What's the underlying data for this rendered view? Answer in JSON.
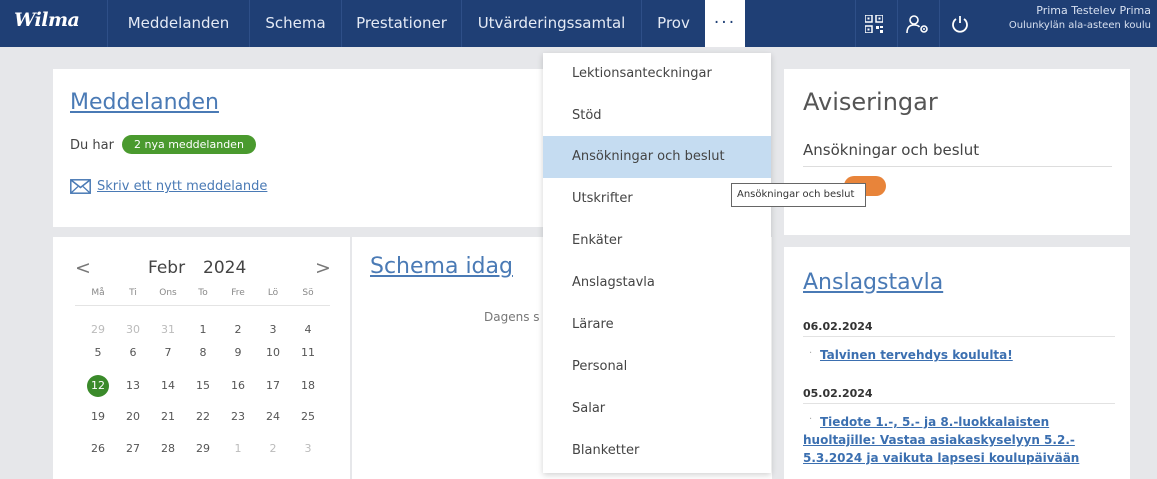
{
  "app": {
    "logo": "Wilma"
  },
  "nav": {
    "items": [
      "Meddelanden",
      "Schema",
      "Prestationer",
      "Utvärderingssamtal",
      "Prov"
    ],
    "more_label": "···"
  },
  "header_icons": [
    "qr-code-icon",
    "user-settings-icon",
    "power-icon"
  ],
  "user": {
    "name": "Prima Testelev Prima",
    "school": "Oulunkylän ala-asteen koulu"
  },
  "messages": {
    "title": "Meddelanden",
    "you_have": "Du har",
    "badge": "2 nya meddelanden",
    "write_new": "Skriv ett nytt meddelande"
  },
  "calendar": {
    "month": "Febr",
    "year": "2024",
    "prev": "<",
    "next": ">",
    "weekdays": [
      "Må",
      "Ti",
      "Ons",
      "To",
      "Fre",
      "Lö",
      "Sö"
    ],
    "weeks": [
      [
        "29",
        "30",
        "31",
        "1",
        "2",
        "3",
        "4"
      ],
      [
        "5",
        "6",
        "7",
        "8",
        "9",
        "10",
        "11"
      ],
      [
        "12",
        "13",
        "14",
        "15",
        "16",
        "17",
        "18"
      ],
      [
        "19",
        "20",
        "21",
        "22",
        "23",
        "24",
        "25"
      ],
      [
        "26",
        "27",
        "28",
        "29",
        "1",
        "2",
        "3"
      ]
    ],
    "today": "12"
  },
  "schedule": {
    "title": "Schema idag",
    "empty_text": "Dagens s"
  },
  "dropdown": {
    "items": [
      "Lektionsanteckningar",
      "Stöd",
      "Ansökningar och beslut",
      "Utskrifter",
      "Enkäter",
      "Anslagstavla",
      "Lärare",
      "Personal",
      "Salar",
      "Blanketter"
    ],
    "active_index": 2
  },
  "tooltip": "Ansökningar och beslut",
  "notices": {
    "title": "Aviseringar",
    "item": "Ansökningar och beslut"
  },
  "board": {
    "title": "Anslagstavla",
    "entries": [
      {
        "date": "06.02.2024",
        "lines": [
          "Talvinen tervehdys koululta!"
        ]
      },
      {
        "date": "05.02.2024",
        "lines": [
          "Tiedote 1.-, 5.- ja 8.-luokkalaisten",
          "huoltajille: Vastaa asiakaskyselyyn 5.2.-",
          "5.3.2024 ja vaikuta lapsesi koulupäivään"
        ]
      }
    ]
  },
  "colors": {
    "nav_bg": "#1f3f75",
    "link": "#4a7ab5",
    "badge": "#4a9a2e",
    "today": "#3a8a2a",
    "menu_active": "#c5dcf1",
    "notice_chip": "#e8843a"
  }
}
